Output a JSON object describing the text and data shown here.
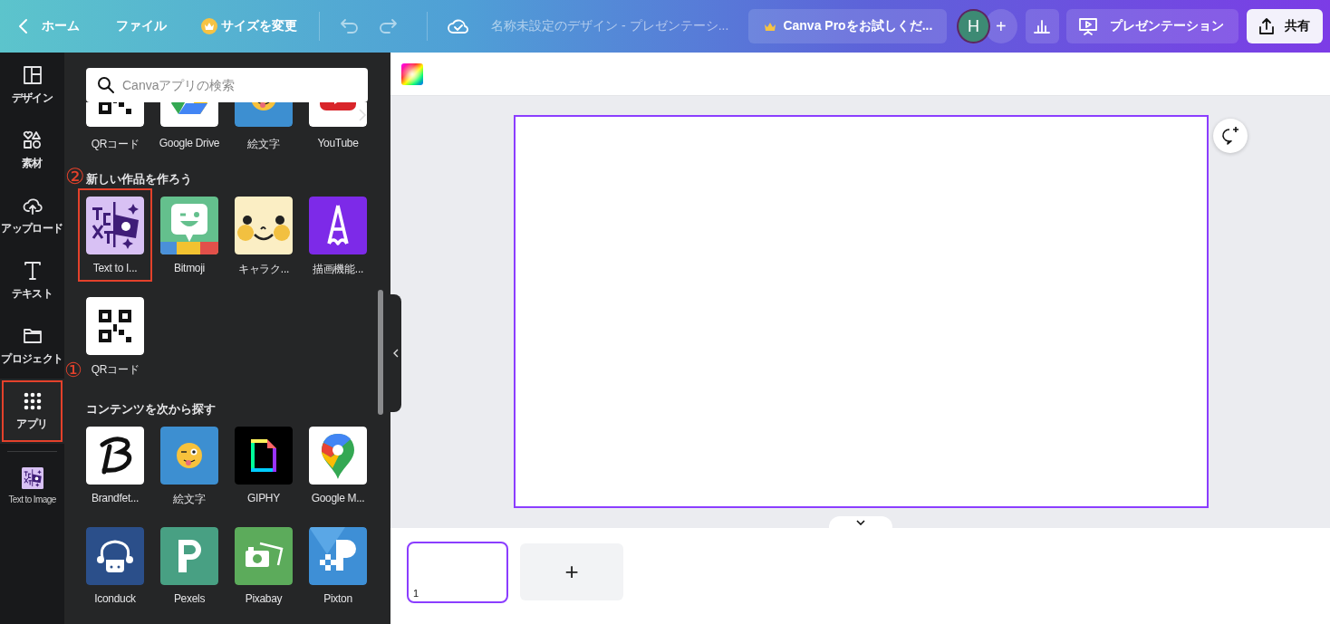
{
  "top_bar": {
    "home": "ホーム",
    "file": "ファイル",
    "resize": "サイズを変更",
    "title": "名称未設定のデザイン - プレゼンテーシ...",
    "pro_button": "Canva Proをお試しくだ...",
    "avatar": "H",
    "add": "+",
    "present": "プレゼンテーション",
    "share": "共有"
  },
  "rail": {
    "items": [
      {
        "label": "デザイン",
        "kind": "layout",
        "selected": false,
        "marked": false
      },
      {
        "label": "素材",
        "kind": "shapes",
        "selected": false,
        "marked": false
      },
      {
        "label": "アップロード",
        "kind": "upload",
        "selected": false,
        "marked": false
      },
      {
        "label": "テキスト",
        "kind": "text",
        "selected": false,
        "marked": false
      },
      {
        "label": "プロジェクト",
        "kind": "folder",
        "selected": false,
        "marked": false
      },
      {
        "label": "アプリ",
        "kind": "grid",
        "selected": true,
        "marked": true,
        "badge": "①"
      }
    ],
    "pinned": {
      "label": "Text to Image",
      "kind": "text2img"
    }
  },
  "panel": {
    "search": {
      "placeholder": "Canvaアプリの検索"
    },
    "partial_row": [
      {
        "label": "QRコード",
        "kind": "qr"
      },
      {
        "label": "Google Drive",
        "kind": "drive"
      },
      {
        "label": "絵文字",
        "kind": "emoji"
      },
      {
        "label": "YouTube",
        "kind": "youtube"
      }
    ],
    "sections": [
      {
        "heading": "新しい作品を作ろう",
        "apps": [
          {
            "label": "Text to I...",
            "kind": "text2img",
            "marked": true,
            "badge": "②"
          },
          {
            "label": "Bitmoji",
            "kind": "bitmoji",
            "marked": false
          },
          {
            "label": "キャラク...",
            "kind": "character",
            "marked": false
          },
          {
            "label": "描画機能...",
            "kind": "draw",
            "marked": false
          },
          {
            "label": "QRコード",
            "kind": "qr",
            "marked": false
          }
        ]
      },
      {
        "heading": "コンテンツを次から探す",
        "apps": [
          {
            "label": "Brandfet...",
            "kind": "brandfetch",
            "marked": false
          },
          {
            "label": "絵文字",
            "kind": "emoji",
            "marked": false
          },
          {
            "label": "GIPHY",
            "kind": "giphy",
            "marked": false
          },
          {
            "label": "Google M...",
            "kind": "gmaps",
            "marked": false
          },
          {
            "label": "Iconduck",
            "kind": "iconduck",
            "marked": false
          },
          {
            "label": "Pexels",
            "kind": "pexels",
            "marked": false
          },
          {
            "label": "Pixabay",
            "kind": "pixabay",
            "marked": false
          },
          {
            "label": "Pixton",
            "kind": "pixton",
            "marked": false
          }
        ]
      }
    ]
  },
  "pages": [
    {
      "number": "1",
      "selected": true
    }
  ],
  "add_page": "+"
}
